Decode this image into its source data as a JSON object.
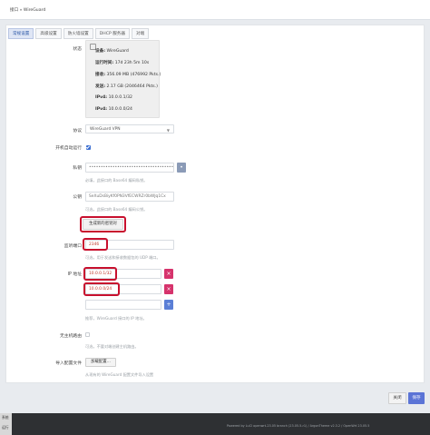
{
  "window": {
    "breadcrumb": "接口 » WireGuard"
  },
  "tabs": [
    {
      "label": "常规设置",
      "active": true
    },
    {
      "label": "高级设置",
      "active": false
    },
    {
      "label": "防火墙设置",
      "active": false
    },
    {
      "label": "DHCP 服务器",
      "active": false
    },
    {
      "label": "对端",
      "active": false
    }
  ],
  "status": {
    "label": "状态",
    "rows": [
      {
        "key": "设备:",
        "value": "WireGuard"
      },
      {
        "key": "运行时间:",
        "value": "17d 23h 5m 10s"
      },
      {
        "key": "接收:",
        "value": "356.09 MB (476992 Pkts.)"
      },
      {
        "key": "发送:",
        "value": "2.17 GB (2046464 Pkts.)"
      },
      {
        "key": "IPv4:",
        "value": "10.0.0.1/32"
      },
      {
        "key": "IPv4:",
        "value": "10.0.0.0/24"
      }
    ]
  },
  "protocol": {
    "label": "协议",
    "value": "WireGuard VPN"
  },
  "autostart": {
    "label": "开机自动运行",
    "checked": true
  },
  "private_key": {
    "label": "私钥",
    "value": "••••••••••••••••••••••••••••••••••••••••••••",
    "hint": "必填，此接口的 Base64 编码私钥。"
  },
  "public_key": {
    "label": "公钥",
    "value": "SeXuDsBiyKf0PN3VfECWRZr0bWJq1Cx",
    "hint": "可选，此接口的 Base64 编码公钥。",
    "generate_button": "生成新的密钥对"
  },
  "listen_port": {
    "label": "监听端口",
    "value": "2346",
    "hint": "可选，用于发送和接收数据包的 UDP 端口。"
  },
  "ip_addresses": {
    "label": "IP 地址",
    "entries": [
      "10.0.0.1/32",
      "10.0.0.0/24"
    ],
    "hint": "推荐，WireGuard 接口的 IP 地址。"
  },
  "no_host_route": {
    "label": "无主机路由",
    "hint": "可选，不要对端创建主机路由。"
  },
  "import_config": {
    "label": "导入配置文件",
    "button": "加载配置...",
    "hint": "从现有的 WireGuard 配置文件导入设置"
  },
  "actions": {
    "close": "关闭",
    "save": "保存"
  },
  "footer": {
    "left_lines": [
      "系统",
      "运行"
    ],
    "text": "Powered by LuCI openwrt-23.05 branch (23.05.5-r1) / ArgonTheme v2.3.2 / OpenWrt 23.05.5"
  },
  "colors": {
    "accent": "#5b74d6",
    "danger": "#d6336c",
    "highlight_ring": "#c8102e"
  }
}
